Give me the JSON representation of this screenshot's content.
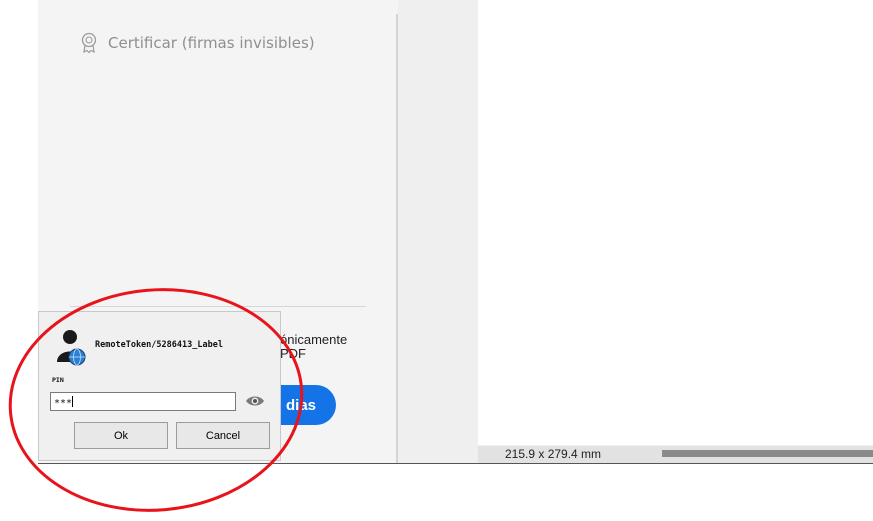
{
  "sidebar": {
    "certify_label": "Certificar (firmas invisibles)",
    "promo_line1": "ónicamente",
    "promo_line2": "PDF",
    "promo_button": "dias"
  },
  "document": {
    "page_size": "215.9 x 279.4 mm"
  },
  "pin_dialog": {
    "title": "RemoteToken/5286413_Label",
    "pin_label": "PIN",
    "pin_value": "***",
    "ok_label": "Ok",
    "cancel_label": "Cancel"
  },
  "colors": {
    "accent": "#1473e6",
    "annotation": "#e8141b"
  },
  "icons": {
    "certify": "certificate-badge-icon",
    "avatar": "user-globe-icon",
    "reveal": "eye-icon"
  }
}
